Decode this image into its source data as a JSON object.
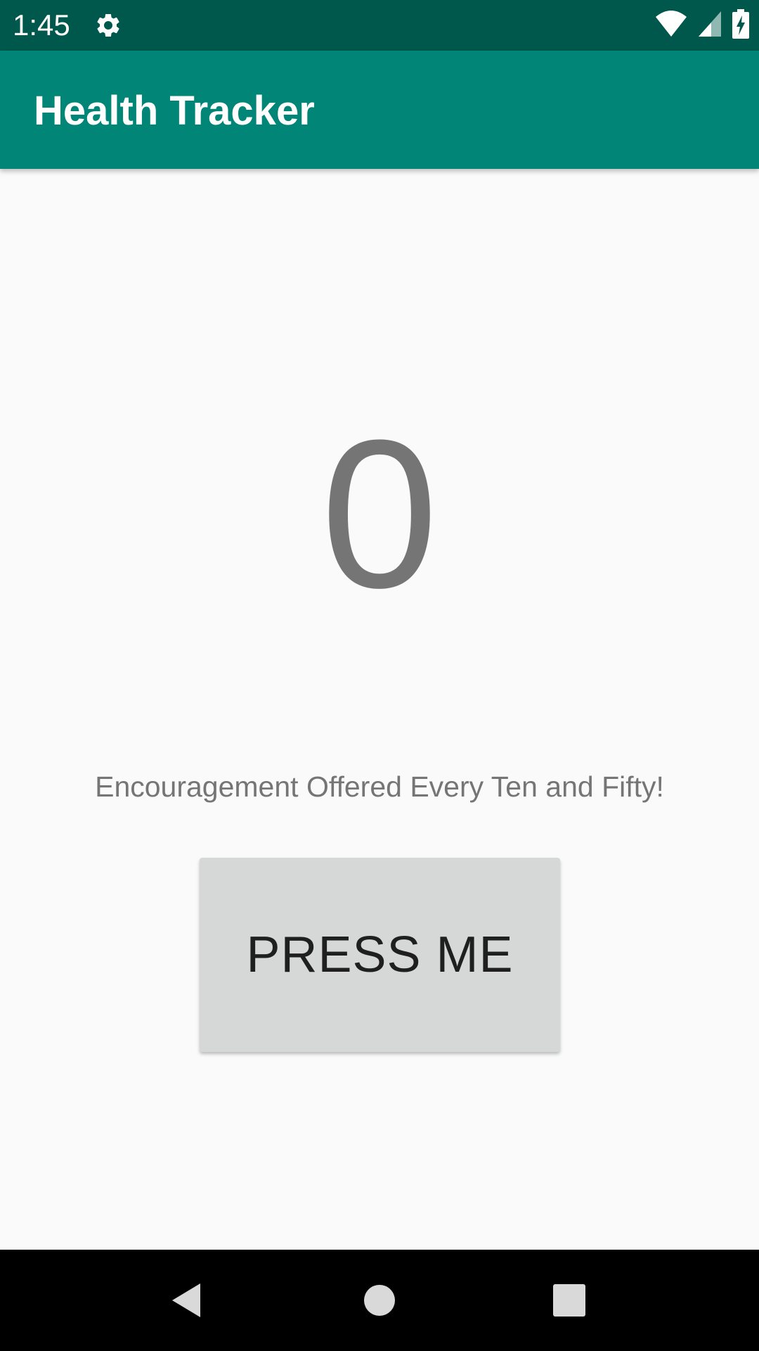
{
  "status_bar": {
    "time": "1:45",
    "icons": [
      "gear-icon",
      "wifi-icon",
      "signal-icon",
      "battery-charging-icon"
    ]
  },
  "app_bar": {
    "title": "Health Tracker"
  },
  "main": {
    "counter_value": "0",
    "encouragement_text": "Encouragement Offered Every Ten and Fifty!",
    "button_label": "PRESS ME"
  },
  "nav_bar": {
    "icons": [
      "back-icon",
      "home-icon",
      "recents-icon"
    ]
  },
  "colors": {
    "status_bar": "#00574b",
    "app_bar": "#008577",
    "background": "#fafafa",
    "counter_text": "#757575",
    "button_bg": "#d6d7d7",
    "nav_bar": "#000000"
  }
}
